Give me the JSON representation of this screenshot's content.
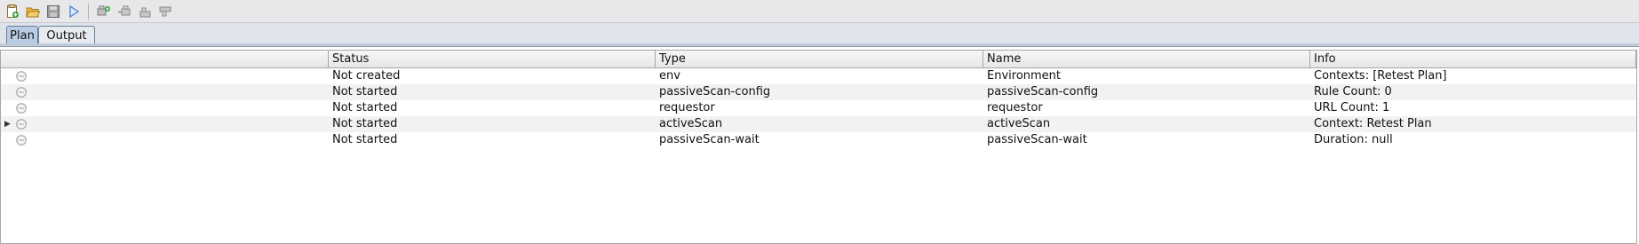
{
  "toolbar": {
    "buttons": [
      {
        "name": "new-plan-icon"
      },
      {
        "name": "open-plan-icon"
      },
      {
        "name": "save-plan-icon"
      },
      {
        "name": "run-plan-icon"
      },
      {
        "name": "add-job-icon"
      },
      {
        "name": "remove-job-icon"
      },
      {
        "name": "move-job-up-icon"
      },
      {
        "name": "move-job-down-icon"
      }
    ]
  },
  "tabs": [
    {
      "label": "Plan",
      "active": true
    },
    {
      "label": "Output",
      "active": false
    }
  ],
  "table": {
    "columns": [
      "",
      "Status",
      "Type",
      "Name",
      "Info"
    ],
    "rows": [
      {
        "expandable": false,
        "status": "Not created",
        "type": "env",
        "name": "Environment",
        "info": "Contexts: [Retest Plan]"
      },
      {
        "expandable": false,
        "status": "Not started",
        "type": "passiveScan-config",
        "name": "passiveScan-config",
        "info": "Rule Count: 0"
      },
      {
        "expandable": false,
        "status": "Not started",
        "type": "requestor",
        "name": "requestor",
        "info": "URL Count: 1"
      },
      {
        "expandable": true,
        "status": "Not started",
        "type": "activeScan",
        "name": "activeScan",
        "info": "Context: Retest Plan"
      },
      {
        "expandable": false,
        "status": "Not started",
        "type": "passiveScan-wait",
        "name": "passiveScan-wait",
        "info": "Duration: null"
      }
    ]
  },
  "colors": {
    "active_tab": "#b9cce3",
    "row_alt": "#f2f2f2",
    "run_icon": "#3d7bd6",
    "new_icon_accent": "#2e9e2e"
  }
}
